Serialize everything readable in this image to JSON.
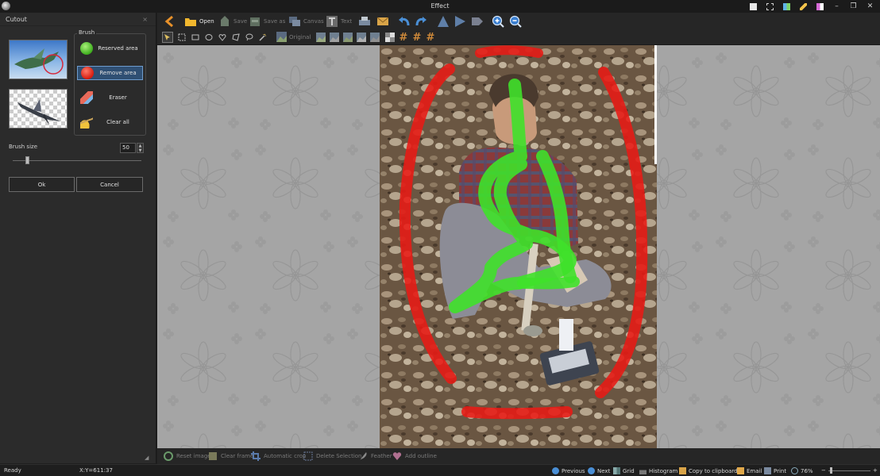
{
  "window": {
    "title": "Effect"
  },
  "panel": {
    "title": "Cutout",
    "close_glyph": "×",
    "brush_legend": "Brush",
    "brush_options": [
      {
        "label": "Reserved area",
        "icon": "green-dot-icon",
        "selected": false
      },
      {
        "label": "Remove area",
        "icon": "red-dot-icon",
        "selected": true
      },
      {
        "label": "Eraser",
        "icon": "eraser-icon",
        "selected": false
      },
      {
        "label": "Clear all",
        "icon": "broom-icon",
        "selected": false
      }
    ],
    "brush_size_label": "Brush size",
    "brush_size_value": "50",
    "brush_size_slider_fraction": 0.11,
    "ok_label": "Ok",
    "cancel_label": "Cancel"
  },
  "toolbar": {
    "open": "Open",
    "save": "Save",
    "save_as": "Save as",
    "canvas": "Canvas",
    "text": "Text"
  },
  "selection_toolbar": {
    "original": "Original"
  },
  "actions": {
    "reset_image": "Reset image",
    "clear_frame": "Clear frame",
    "automatic_crop": "Automatic crop",
    "delete_selection": "Delete Selection",
    "feather": "Feather",
    "add_outline": "Add outline"
  },
  "status": {
    "ready": "Ready",
    "coords": "X:Y=611:37",
    "previous": "Previous",
    "next": "Next",
    "grid": "Grid",
    "histogram": "Histogram",
    "copy_clipboard": "Copy to clipboard",
    "email": "Email",
    "print": "Print",
    "zoom": "76%",
    "zoom_minus": "−",
    "zoom_plus": "+"
  },
  "colors": {
    "accent": "#2f4f73",
    "reserved_stroke": "#3fe12a",
    "remove_stroke": "#e81a14",
    "toolbar_orange": "#e8912a"
  }
}
